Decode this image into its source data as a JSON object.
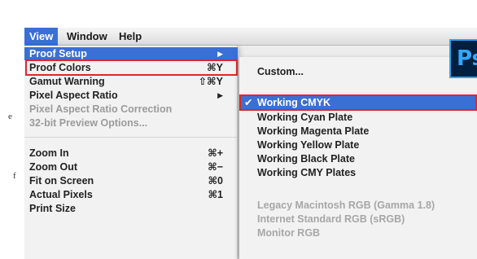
{
  "menubar": {
    "items": [
      "View",
      "Window",
      "Help"
    ]
  },
  "view_menu": {
    "items": [
      {
        "label": "Proof Setup",
        "submenu": true,
        "highlighted": true
      },
      {
        "label": "Proof Colors",
        "shortcut": "⌘Y"
      },
      {
        "label": "Gamut Warning",
        "shortcut": "⇧⌘Y"
      },
      {
        "label": "Pixel Aspect Ratio",
        "submenu": true
      },
      {
        "label": "Pixel Aspect Ratio Correction",
        "disabled": true
      },
      {
        "label": "32-bit Preview Options...",
        "disabled": true
      },
      {
        "label": "Zoom In",
        "shortcut": "⌘+"
      },
      {
        "label": "Zoom Out",
        "shortcut": "⌘−"
      },
      {
        "label": "Fit on Screen",
        "shortcut": "⌘0"
      },
      {
        "label": "Actual Pixels",
        "shortcut": "⌘1"
      },
      {
        "label": "Print Size"
      }
    ]
  },
  "proof_setup_submenu": {
    "items": [
      {
        "label": "Custom..."
      },
      {
        "label": "Working CMYK",
        "checked": true,
        "check": "✔"
      },
      {
        "label": "Working Cyan Plate"
      },
      {
        "label": "Working Magenta Plate"
      },
      {
        "label": "Working Yellow Plate"
      },
      {
        "label": "Working Black Plate"
      },
      {
        "label": "Working CMY Plates"
      },
      {
        "label": "Legacy Macintosh RGB (Gamma 1.8)",
        "disabled": true
      },
      {
        "label": "Internet Standard RGB (sRGB)",
        "disabled": true
      },
      {
        "label": "Monitor RGB",
        "disabled": true
      }
    ]
  },
  "page_fragments": [
    "e",
    "f"
  ],
  "logo": {
    "text": "Ps"
  },
  "colors": {
    "highlight": "#3a6fd6",
    "callout": "#e0262a",
    "logo_bg": "#00203f",
    "logo_accent": "#31a8ff"
  }
}
